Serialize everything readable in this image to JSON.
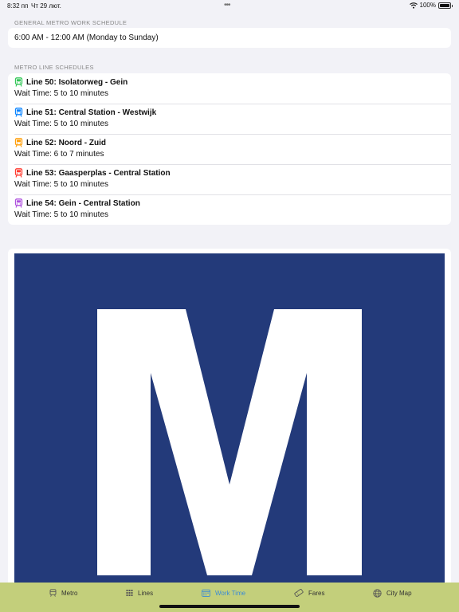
{
  "status_bar": {
    "time": "8:32 пп",
    "date": "Чт 29 лют.",
    "battery": "100%"
  },
  "general_schedule": {
    "header": "GENERAL METRO WORK SCHEDULE",
    "hours": "6:00 AM - 12:00 AM (Monday to Sunday)"
  },
  "lines_section": {
    "header": "METRO LINE SCHEDULES",
    "lines": [
      {
        "title": "Line 50: Isolatorweg - Gein",
        "wait": "Wait Time: 5 to 10 minutes",
        "color": "#34c759"
      },
      {
        "title": "Line 51: Central Station - Westwijk",
        "wait": "Wait Time: 5 to 10 minutes",
        "color": "#0a84ff"
      },
      {
        "title": "Line 52: Noord - Zuid",
        "wait": "Wait Time: 6 to 7 minutes",
        "color": "#ff9f0a"
      },
      {
        "title": "Line 53: Gaasperplas - Central Station",
        "wait": "Wait Time: 5 to 10 minutes",
        "color": "#ff3b30"
      },
      {
        "title": "Line 54: Gein - Central Station",
        "wait": "Wait Time: 5 to 10 minutes",
        "color": "#af52de"
      }
    ]
  },
  "logo": {
    "letter": "M",
    "background": "#233a7a",
    "foreground": "#ffffff"
  },
  "tab_bar": {
    "background": "#c3cf7b",
    "active_color": "#3a8bd6",
    "tabs": [
      {
        "label": "Metro",
        "icon": "tram-icon"
      },
      {
        "label": "Lines",
        "icon": "grid-icon"
      },
      {
        "label": "Work Time",
        "icon": "calendar-icon",
        "active": true
      },
      {
        "label": "Fares",
        "icon": "ticket-icon"
      },
      {
        "label": "City Map",
        "icon": "globe-icon"
      }
    ]
  }
}
